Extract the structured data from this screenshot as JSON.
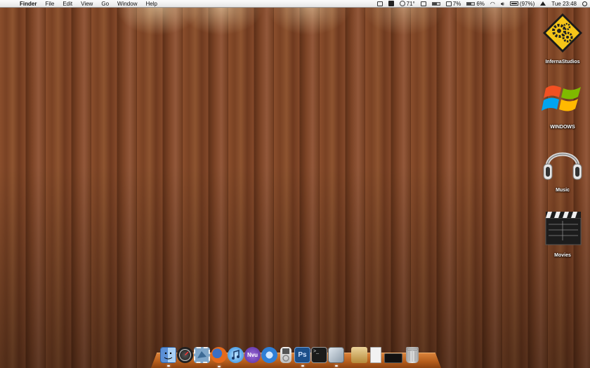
{
  "menubar": {
    "apple_glyph": "",
    "app_name": "Finder",
    "menus": [
      "File",
      "Edit",
      "View",
      "Go",
      "Window",
      "Help"
    ],
    "status": {
      "temperature": "71°",
      "cpu": "7%",
      "other_percent": "6%",
      "battery": "(97%)",
      "clock": "Tue 23:48"
    }
  },
  "desktop": {
    "icons": [
      {
        "label": "InfernaStudios",
        "icon": "gears-warning-sign-icon"
      },
      {
        "label": "WINDOWS",
        "icon": "windows-logo-icon"
      },
      {
        "label": "Music",
        "icon": "headphones-icon"
      },
      {
        "label": "Movies",
        "icon": "clapperboard-icon"
      }
    ]
  },
  "dock": {
    "items": [
      {
        "icon": "finder-icon",
        "color": "#5b8fd6"
      },
      {
        "icon": "dashboard-icon",
        "color": "#2a2a2a"
      },
      {
        "icon": "mail-stamp-icon",
        "color": "#7fa6c9"
      },
      {
        "icon": "firefox-icon",
        "color": "#e46a1c"
      },
      {
        "icon": "itunes-icon",
        "color": "#4ea0e6"
      },
      {
        "icon": "nvu-icon",
        "color": "#6b3fb0"
      },
      {
        "icon": "quicktime-icon",
        "color": "#2f7fd6"
      },
      {
        "icon": "ipod-icon",
        "color": "#d8d8d8"
      },
      {
        "icon": "photoshop-icon",
        "color": "#1c4f8a"
      },
      {
        "icon": "terminal-icon",
        "color": "#1b1b1b"
      },
      {
        "icon": "preview-icon",
        "color": "#a8b4c0"
      },
      {
        "icon": "iphoto-icon",
        "color": "#d9b36a"
      },
      {
        "icon": "document-icon",
        "color": "#f2f2f2"
      },
      {
        "icon": "dvd-player-icon",
        "color": "#111111"
      },
      {
        "icon": "trash-icon",
        "color": "#c8c8c8"
      }
    ]
  },
  "colors": {
    "wood": "#7a4224",
    "dock": "#c46a22",
    "menubar": "#eeeeee"
  }
}
